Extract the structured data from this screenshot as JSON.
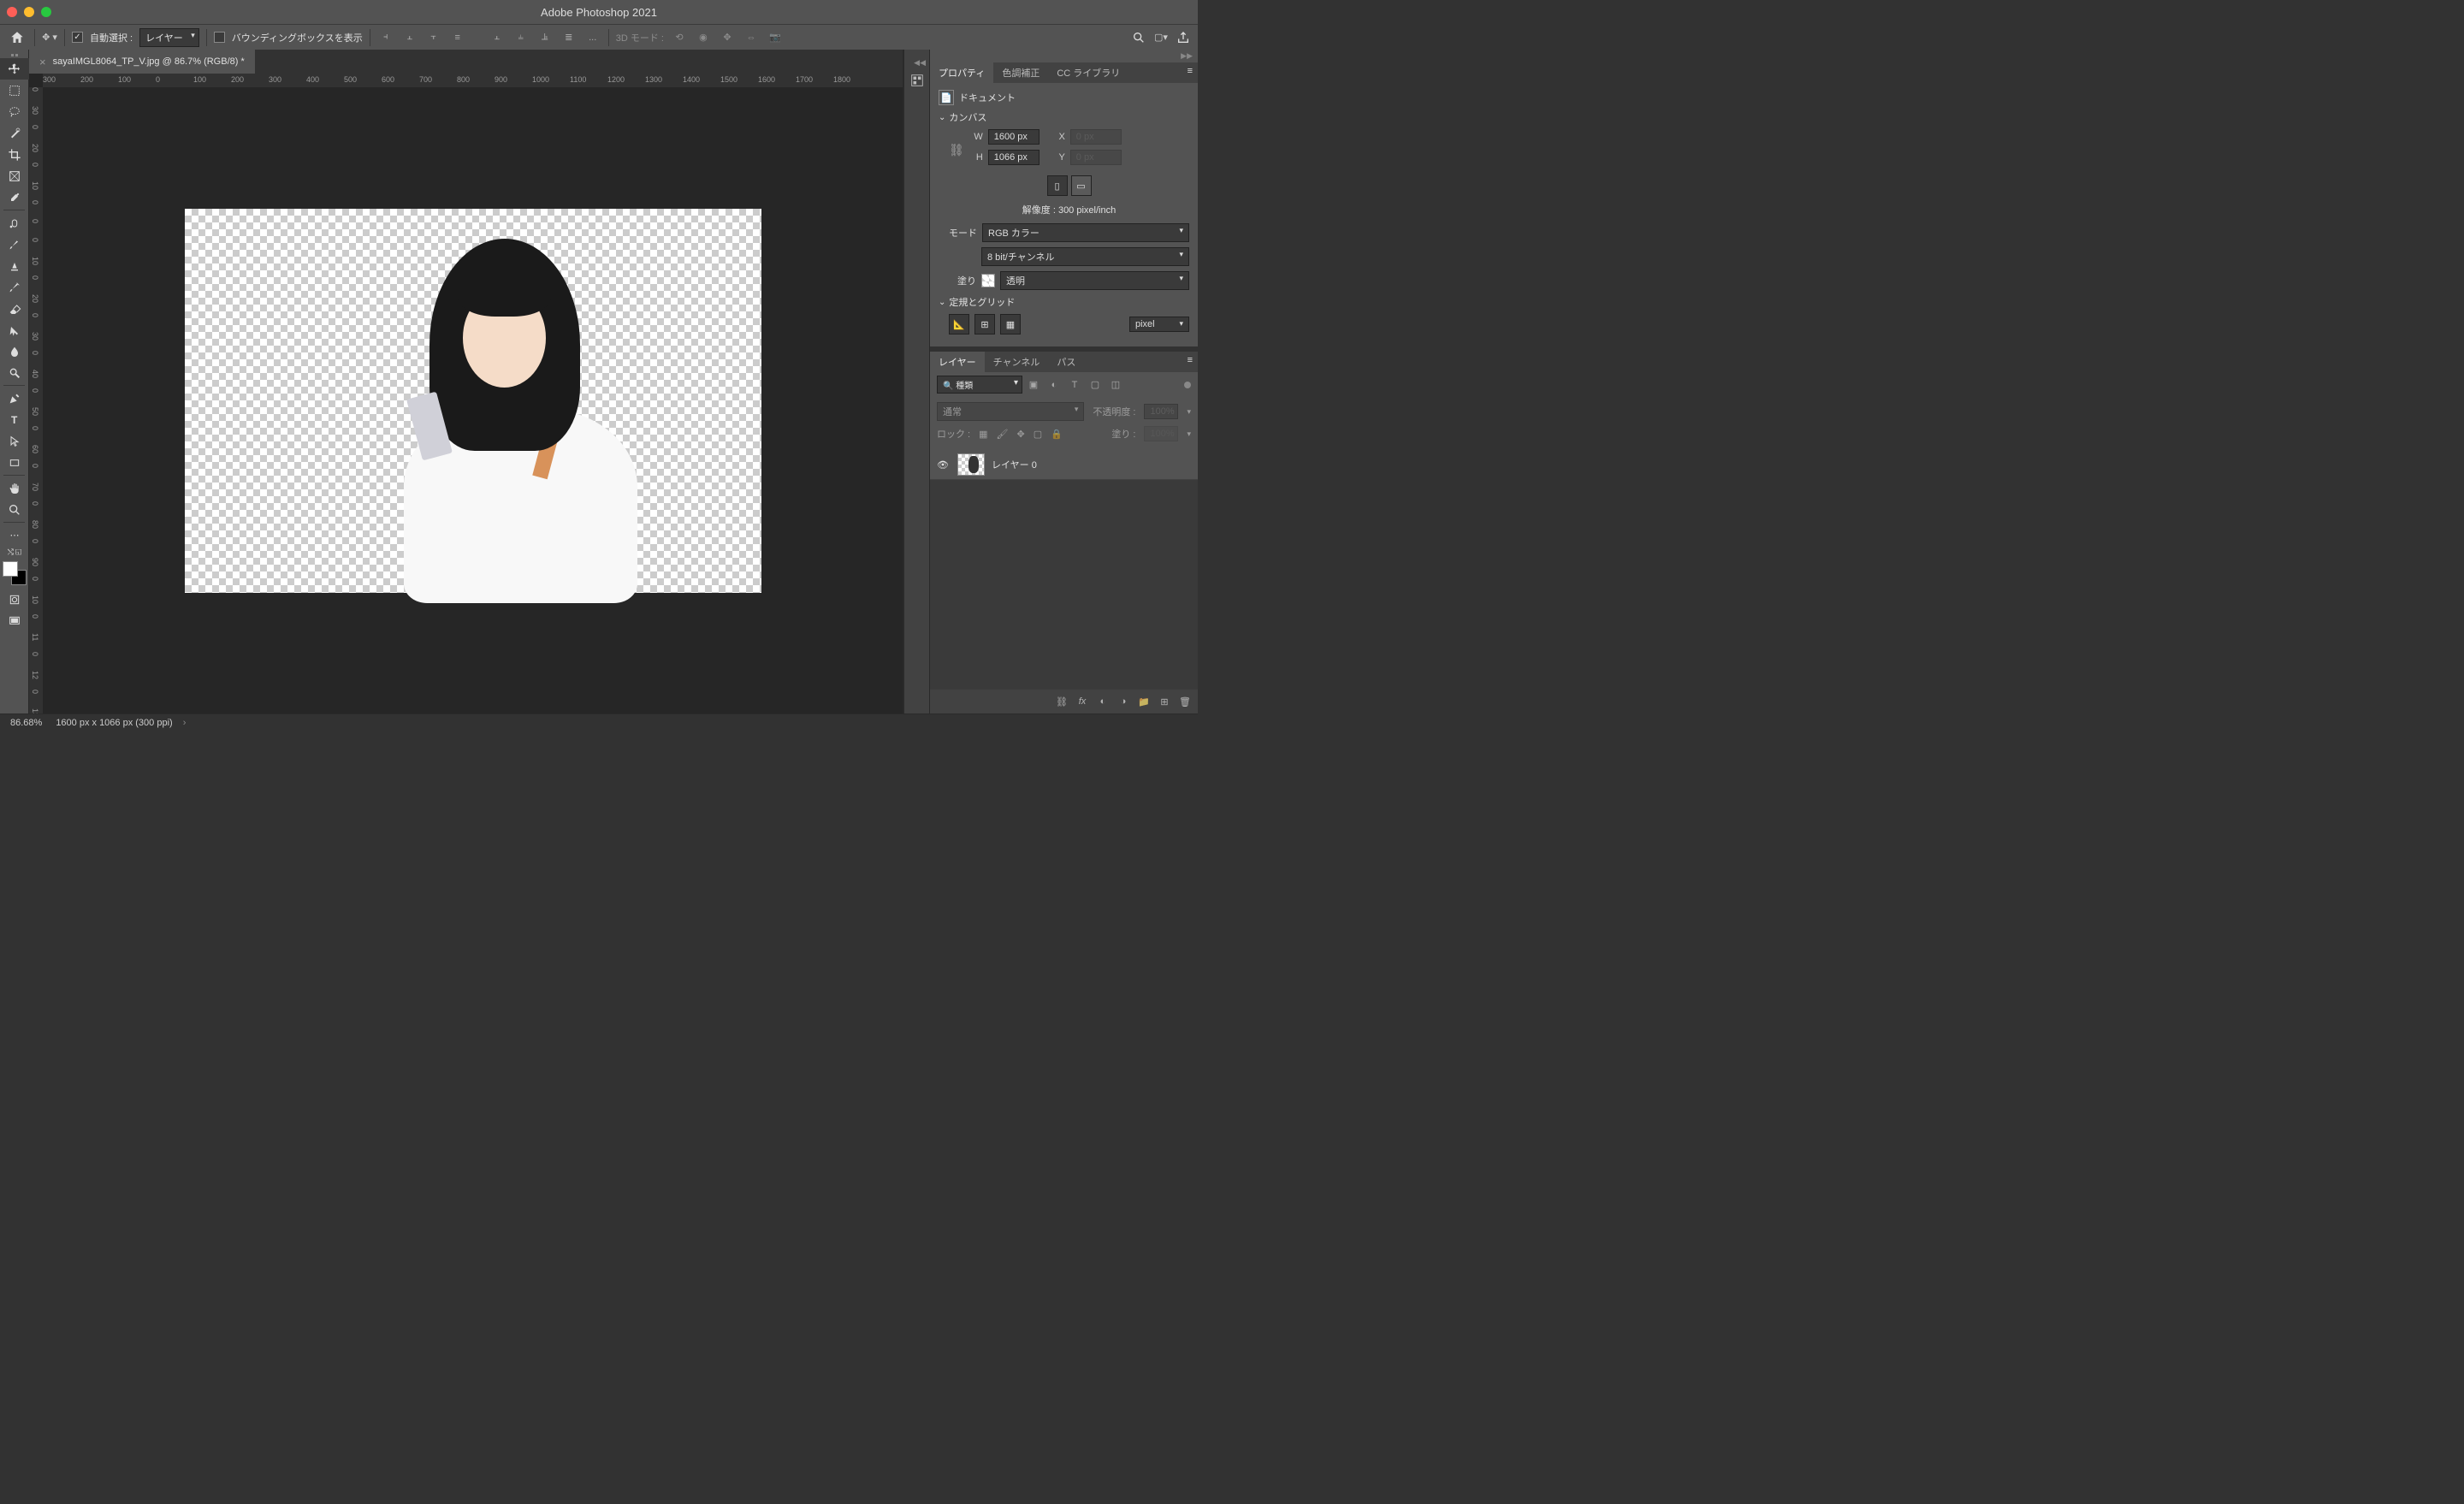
{
  "app": {
    "title": "Adobe Photoshop 2021"
  },
  "options_bar": {
    "auto_select_label": "自動選択 :",
    "auto_select_target": "レイヤー",
    "bounding_box_label": "バウンディングボックスを表示",
    "more": "...",
    "mode_3d_label": "3D モード :"
  },
  "document": {
    "tab_title": "sayaIMGL8064_TP_V.jpg @ 86.7% (RGB/8) *"
  },
  "ruler_h": [
    "300",
    "200",
    "100",
    "0",
    "100",
    "200",
    "300",
    "400",
    "500",
    "600",
    "700",
    "800",
    "900",
    "1000",
    "1100",
    "1200",
    "1300",
    "1400",
    "1500",
    "1600",
    "1700",
    "1800"
  ],
  "ruler_v": [
    "0",
    "30",
    "0",
    "20",
    "0",
    "10",
    "0",
    "0",
    "0",
    "10",
    "0",
    "20",
    "0",
    "30",
    "0",
    "40",
    "0",
    "50",
    "0",
    "60",
    "0",
    "70",
    "0",
    "80",
    "0",
    "90",
    "0",
    "10",
    "0",
    "11",
    "0",
    "12",
    "0",
    "13",
    "0"
  ],
  "properties_panel": {
    "tabs": {
      "properties": "プロパティ",
      "adjustments": "色調補正",
      "cc_libraries": "CC ライブラリ"
    },
    "document_label": "ドキュメント",
    "canvas_section": "カンバス",
    "w_label": "W",
    "w_value": "1600 px",
    "h_label": "H",
    "h_value": "1066 px",
    "x_label": "X",
    "x_value": "0 px",
    "y_label": "Y",
    "y_value": "0 px",
    "resolution": "解像度 : 300 pixel/inch",
    "mode_label": "モード",
    "mode_value": "RGB カラー",
    "bits_value": "8 bit/チャンネル",
    "fill_label": "塗り",
    "fill_value": "透明",
    "rulers_section": "定規とグリッド",
    "unit_value": "pixel"
  },
  "layers_panel": {
    "tabs": {
      "layers": "レイヤー",
      "channels": "チャンネル",
      "paths": "パス"
    },
    "filter_label": "種類",
    "blend_mode": "通常",
    "opacity_label": "不透明度 :",
    "opacity_value": "100%",
    "lock_label": "ロック :",
    "fill_label": "塗り :",
    "fill_value": "100%",
    "layer_name": "レイヤー 0"
  },
  "status_bar": {
    "zoom": "86.68%",
    "dimensions": "1600 px x 1066 px (300 ppi)"
  }
}
